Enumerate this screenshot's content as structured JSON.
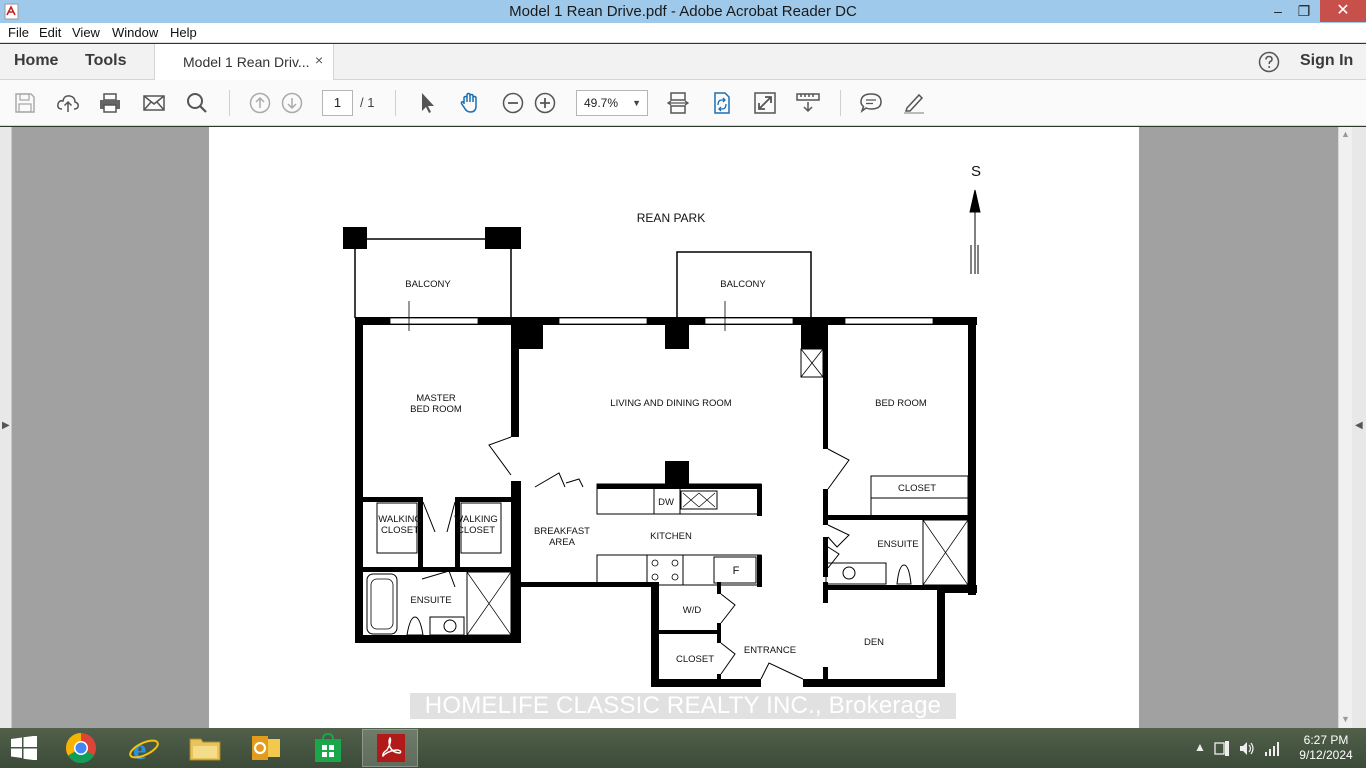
{
  "window": {
    "title": "Model 1 Rean Drive.pdf - Adobe Acrobat Reader DC",
    "minimize": "–",
    "maximize": "❐",
    "close": "✕"
  },
  "menu": [
    "File",
    "Edit",
    "View",
    "Window",
    "Help"
  ],
  "tabs": {
    "home": "Home",
    "tools": "Tools",
    "document": "Model 1 Rean Driv...",
    "close": "×",
    "sign_in": "Sign In"
  },
  "toolbar": {
    "page_current": "1",
    "page_total": "/ 1",
    "zoom": "49.7%"
  },
  "floorplan": {
    "compass": "S",
    "street": "REAN PARK",
    "rooms": {
      "balcony_left": "BALCONY",
      "balcony_right": "BALCONY",
      "master_line1": "MASTER",
      "master_line2": "BED ROOM",
      "living": "LIVING AND DINING ROOM",
      "bedroom": "BED ROOM",
      "closet_right": "CLOSET",
      "walking1_line1": "WALKING",
      "walking1_line2": "CLOSET",
      "walking2_line1": "WALKING",
      "walking2_line2": "CLOSET",
      "dw": "DW",
      "breakfast_line1": "BREAKFAST",
      "breakfast_line2": "AREA",
      "kitchen": "KITCHEN",
      "ensuite_right": "ENSUITE",
      "fridge": "F",
      "ensuite_left": "ENSUITE",
      "wd": "W/D",
      "entrance": "ENTRANCE",
      "den": "DEN",
      "closet_bottom": "CLOSET"
    }
  },
  "watermark": "HOMELIFE CLASSIC REALTY INC., Brokerage",
  "clock": {
    "time": "6:27 PM",
    "date": "9/12/2024"
  }
}
